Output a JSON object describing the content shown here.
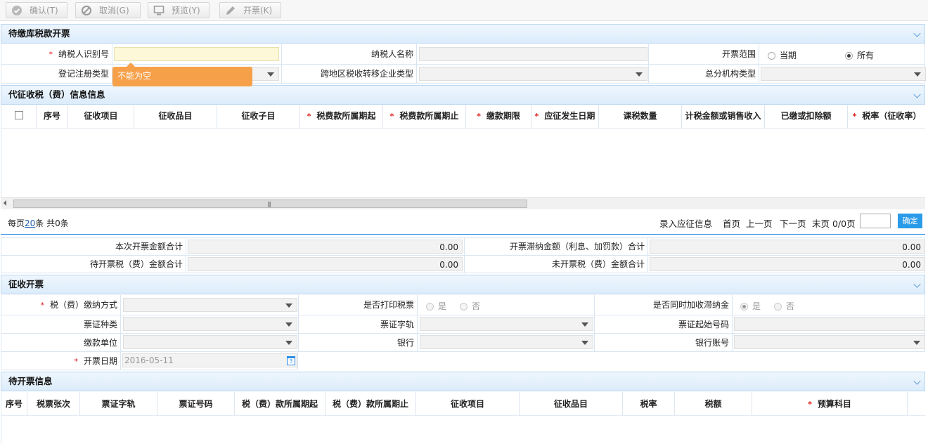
{
  "toolbar": {
    "confirm": "确认(T)",
    "cancel": "取消(G)",
    "preview": "预览(Y)",
    "invoice": "开票(K)"
  },
  "section1": {
    "title": "待缴库税款开票",
    "taxpayer_id_label": "纳税人识别号",
    "taxpayer_id_value": "",
    "taxpayer_name_label": "纳税人名称",
    "invoice_scope_label": "开票范围",
    "scope_current": "当期",
    "scope_all": "所有",
    "reg_type_label": "登记注册类型",
    "cross_region_label": "跨地区税收转移企业类型",
    "branch_type_label": "总分机构类型",
    "error_tooltip": "不能为空"
  },
  "section2": {
    "title": "代征收税（费）信息信息",
    "columns": [
      "序号",
      "征收项目",
      "征收品目",
      "征收子目",
      "税费款所属期起",
      "税费款所属期止",
      "缴款期限",
      "应征发生日期",
      "课税数量",
      "计税金额或销售收入",
      "已缴或扣除额",
      "税率（征收率）"
    ],
    "pagination": {
      "per_page_prefix": "每页",
      "per_page_value": "20",
      "per_page_suffix": "条 共0条",
      "enter_info": "录入应征信息",
      "first": "首页",
      "prev": "上一页",
      "next": "下一页",
      "last": "末页 0/0页",
      "go": "确定"
    }
  },
  "totals": {
    "current_total_label": "本次开票金额合计",
    "current_total_value": "0.00",
    "late_fee_label": "开票滞纳金额（利息、加罚款）合计",
    "late_fee_value": "0.00",
    "pending_label": "待开票税（费）金额合计",
    "pending_value": "0.00",
    "uninvoiced_label": "未开票税（费）金额合计",
    "uninvoiced_value": "0.00"
  },
  "section3": {
    "title": "征收开票",
    "pay_method_label": "税（费）缴纳方式",
    "print_label": "是否打印税票",
    "yes": "是",
    "no": "否",
    "late_fee_label": "是否同时加收滞纳金",
    "ticket_type_label": "票证种类",
    "ticket_track_label": "票证字轨",
    "ticket_start_label": "票证起始号码",
    "pay_unit_label": "缴款单位",
    "bank_label": "银行",
    "bank_account_label": "银行账号",
    "date_label": "开票日期",
    "date_value": "2016-05-11"
  },
  "section4": {
    "title": "待开票信息",
    "columns": [
      "序号",
      "税票张次",
      "票证字轨",
      "票证号码",
      "税（费）款所属期起",
      "税（费）款所属期止",
      "征收项目",
      "征收品目",
      "税率",
      "税额",
      "预算科目"
    ]
  },
  "colors": {
    "accent": "#2a8de6",
    "header_bg": "#dcecfb",
    "error": "#f6a049"
  }
}
